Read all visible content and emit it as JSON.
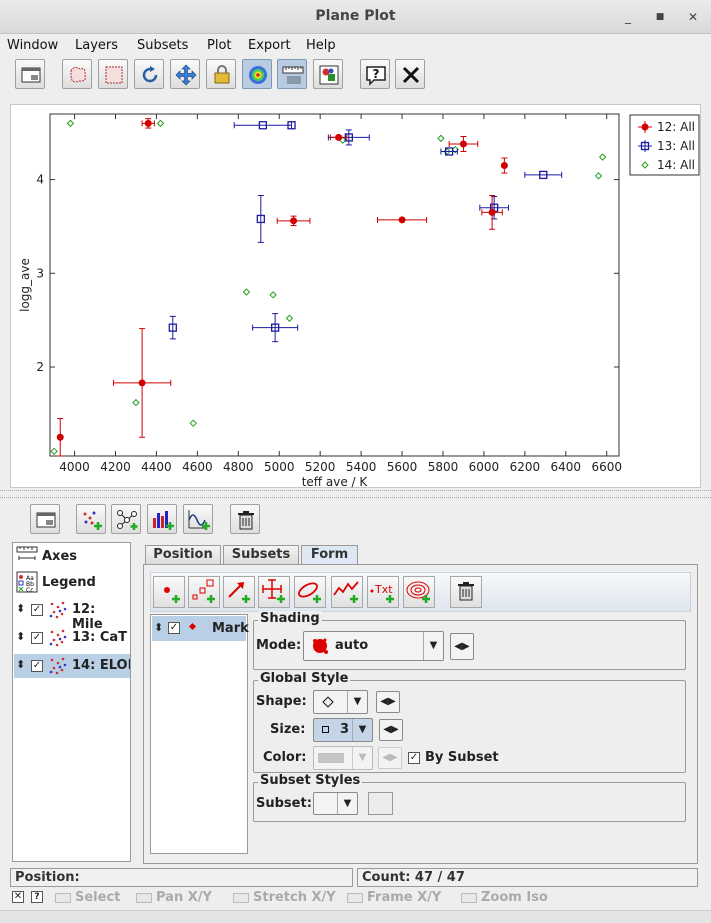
{
  "window": {
    "title": "Plane Plot"
  },
  "menu": [
    "Window",
    "Layers",
    "Subsets",
    "Plot",
    "Export",
    "Help"
  ],
  "plot": {
    "xlabel": "teff ave / K",
    "ylabel": "logg_ave",
    "xticks": [
      "4000",
      "4200",
      "4400",
      "4600",
      "4800",
      "5000",
      "5200",
      "5400",
      "5600",
      "5800",
      "6000",
      "6200",
      "6400",
      "6600"
    ],
    "yticks": [
      "2",
      "3",
      "4"
    ],
    "legend": [
      "12: All",
      "13: All",
      "14: All"
    ]
  },
  "chart_data": {
    "type": "scatter",
    "xlabel": "teff ave / K",
    "ylabel": "logg_ave",
    "xlim": [
      3880,
      6660
    ],
    "ylim": [
      1.05,
      4.7
    ],
    "series": [
      {
        "name": "12: All",
        "color": "#d00000",
        "marker": "filled-circle",
        "points": [
          {
            "x": 3930,
            "y": 1.25,
            "ex": 0,
            "ey": 0.2
          },
          {
            "x": 4330,
            "y": 1.83,
            "ex": 140,
            "ey": 0.58
          },
          {
            "x": 4360,
            "y": 4.6,
            "ex": 30,
            "ey": 0.05
          },
          {
            "x": 5070,
            "y": 3.56,
            "ex": 80,
            "ey": 0.05
          },
          {
            "x": 5290,
            "y": 4.45,
            "ex": 40,
            "ey": 0.02
          },
          {
            "x": 5600,
            "y": 3.57,
            "ex": 120,
            "ey": 0
          },
          {
            "x": 5900,
            "y": 4.38,
            "ex": 70,
            "ey": 0.08
          },
          {
            "x": 6040,
            "y": 3.65,
            "ex": 50,
            "ey": 0.18
          },
          {
            "x": 6100,
            "y": 4.15,
            "ex": 0,
            "ey": 0.08
          }
        ]
      },
      {
        "name": "13: All",
        "color": "#1a1aa0",
        "marker": "open-square",
        "points": [
          {
            "x": 4480,
            "y": 2.42,
            "ex": 0,
            "ey": 0.12
          },
          {
            "x": 4910,
            "y": 3.58,
            "ex": 0,
            "ey": 0.25
          },
          {
            "x": 4920,
            "y": 4.58,
            "ex": 140,
            "ey": 0
          },
          {
            "x": 4980,
            "y": 2.42,
            "ex": 110,
            "ey": 0.15
          },
          {
            "x": 5060,
            "y": 4.58,
            "ex": 0,
            "ey": 0
          },
          {
            "x": 5340,
            "y": 4.45,
            "ex": 100,
            "ey": 0.08
          },
          {
            "x": 5830,
            "y": 4.3,
            "ex": 40,
            "ey": 0
          },
          {
            "x": 6050,
            "y": 3.7,
            "ex": 70,
            "ey": 0.12
          },
          {
            "x": 6290,
            "y": 4.05,
            "ex": 90,
            "ey": 0
          }
        ]
      },
      {
        "name": "14: All",
        "color": "#22a022",
        "marker": "open-diamond",
        "points": [
          {
            "x": 3900,
            "y": 1.1
          },
          {
            "x": 3980,
            "y": 4.6
          },
          {
            "x": 4300,
            "y": 1.62
          },
          {
            "x": 4420,
            "y": 4.6
          },
          {
            "x": 4580,
            "y": 1.4
          },
          {
            "x": 4840,
            "y": 2.8
          },
          {
            "x": 4970,
            "y": 2.77
          },
          {
            "x": 5050,
            "y": 2.52
          },
          {
            "x": 5310,
            "y": 4.42
          },
          {
            "x": 5790,
            "y": 4.44
          },
          {
            "x": 5820,
            "y": 4.3
          },
          {
            "x": 6560,
            "y": 4.04
          },
          {
            "x": 6580,
            "y": 4.24
          },
          {
            "x": 5860,
            "y": 4.32
          }
        ]
      }
    ]
  },
  "layers": {
    "axes_label": "Axes",
    "legend_label": "Legend",
    "items": [
      {
        "label": "12: Mile",
        "checked": true
      },
      {
        "label": "13: CaT",
        "checked": true
      },
      {
        "label": "14: ELOI",
        "checked": true
      }
    ]
  },
  "tabs": [
    "Position",
    "Subsets",
    "Form"
  ],
  "marklist": {
    "label": "Mark"
  },
  "shading": {
    "title": "Shading",
    "mode_label": "Mode:",
    "mode_value": "auto"
  },
  "global_style": {
    "title": "Global Style",
    "shape_label": "Shape:",
    "size_label": "Size:",
    "size_value": "3",
    "color_label": "Color:",
    "by_subset_label": "By Subset"
  },
  "subset_styles": {
    "title": "Subset Styles",
    "subset_label": "Subset:"
  },
  "status": {
    "position_label": "Position:",
    "count": "Count: 47 / 47"
  },
  "modes": [
    "Select",
    "Pan X/Y",
    "Stretch X/Y",
    "Frame X/Y",
    "Zoom Iso"
  ]
}
